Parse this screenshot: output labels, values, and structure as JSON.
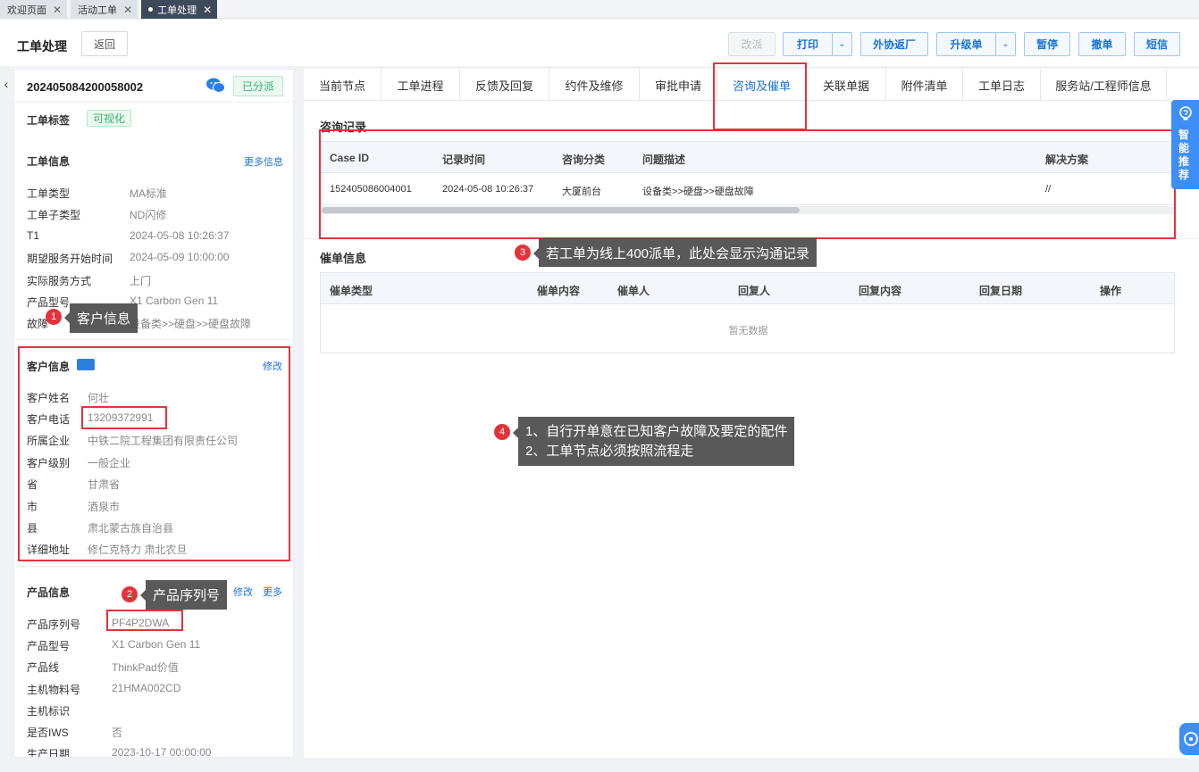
{
  "window_tabs": [
    {
      "label": "欢迎页面",
      "close": "✕"
    },
    {
      "label": "活动工单",
      "close": "✕"
    },
    {
      "label": "工单处理",
      "close": "✕"
    }
  ],
  "header": {
    "title": "工单处理",
    "back": "返回",
    "actions": {
      "modify": "改派",
      "print": "打印",
      "external": "外协返厂",
      "upgrade": "升级单",
      "pause": "暂停",
      "cancel": "撤单",
      "sms": "短信"
    }
  },
  "left": {
    "order_no": "202405084200058002",
    "status": "已分派",
    "tag_label": "工单标签",
    "tag_value": "可视化",
    "order_info": {
      "title": "工单信息",
      "more": "更多信息",
      "fields": [
        {
          "label": "工单类型",
          "value": "MA标准"
        },
        {
          "label": "工单子类型",
          "value": "ND闪修"
        },
        {
          "label": "T1",
          "value": "2024-05-08 10:26:37"
        },
        {
          "label": "期望服务开始时间",
          "value": "2024-05-09 10:00:00"
        },
        {
          "label": "实际服务方式",
          "value": "上门"
        },
        {
          "label": "产品型号",
          "value": "X1 Carbon Gen 11"
        },
        {
          "label": "故障",
          "value": "设备类>>硬盘>>硬盘故障"
        }
      ]
    },
    "customer": {
      "title": "客户信息",
      "edit": "修改",
      "fields": [
        {
          "label": "客户姓名",
          "value": "何壮"
        },
        {
          "label": "客户电话",
          "value": "13209372991"
        },
        {
          "label": "所属企业",
          "value": "中铁二院工程集团有限责任公司"
        },
        {
          "label": "客户级别",
          "value": "一般企业"
        },
        {
          "label": "省",
          "value": "甘肃省"
        },
        {
          "label": "市",
          "value": "酒泉市"
        },
        {
          "label": "县",
          "value": "肃北蒙古族自治县"
        },
        {
          "label": "详细地址",
          "value": "修仁克特力 肃北农旦"
        }
      ]
    },
    "product": {
      "title": "产品信息",
      "edit": "修改",
      "more": "更多",
      "fields": [
        {
          "label": "产品序列号",
          "value": "PF4P2DWA"
        },
        {
          "label": "产品型号",
          "value": "X1 Carbon Gen 11"
        },
        {
          "label": "产品线",
          "value": "ThinkPad价值"
        },
        {
          "label": "主机物料号",
          "value": "21HMA002CD"
        },
        {
          "label": "主机标识",
          "value": ""
        },
        {
          "label": "是否IWS",
          "value": "否"
        },
        {
          "label": "生产日期",
          "value": "2023-10-17 00:00:00"
        }
      ]
    }
  },
  "tabs": [
    "当前节点",
    "工单进程",
    "反馈及回复",
    "约件及维修",
    "审批申请",
    "咨询及催单",
    "关联单据",
    "附件清单",
    "工单日志",
    "服务站/工程师信息"
  ],
  "consult": {
    "title": "咨询记录",
    "columns": [
      "Case ID",
      "记录时间",
      "咨询分类",
      "问题描述",
      "解决方案"
    ],
    "rows": [
      {
        "case_id": "152405086004001",
        "time": "2024-05-08 10:26:37",
        "category": "大厦前台",
        "desc": "设备类>>硬盘>>硬盘故障",
        "solution": "//"
      }
    ]
  },
  "urge": {
    "title": "催单信息",
    "columns": [
      "催单类型",
      "催单内容",
      "催单人",
      "回复人",
      "回复内容",
      "回复日期",
      "操作"
    ],
    "empty": "暂无数据"
  },
  "callouts": {
    "c1": {
      "num": "1",
      "text": "客户信息"
    },
    "c2": {
      "num": "2",
      "text": "产品序列号"
    },
    "c3": {
      "num": "3",
      "text": "若工单为线上400派单，此处会显示沟通记录"
    },
    "c4": {
      "num": "4",
      "line1": "1、自行开单意在已知客户故障及要定的配件",
      "line2": "2、工单节点必须按照流程走"
    }
  },
  "recommend": {
    "text": "智能推荐"
  },
  "colors": {
    "primary": "#1a73d9",
    "success": "#2fb36b",
    "annotation": "#e5323a",
    "callout_bg": "#4b4b4b"
  }
}
